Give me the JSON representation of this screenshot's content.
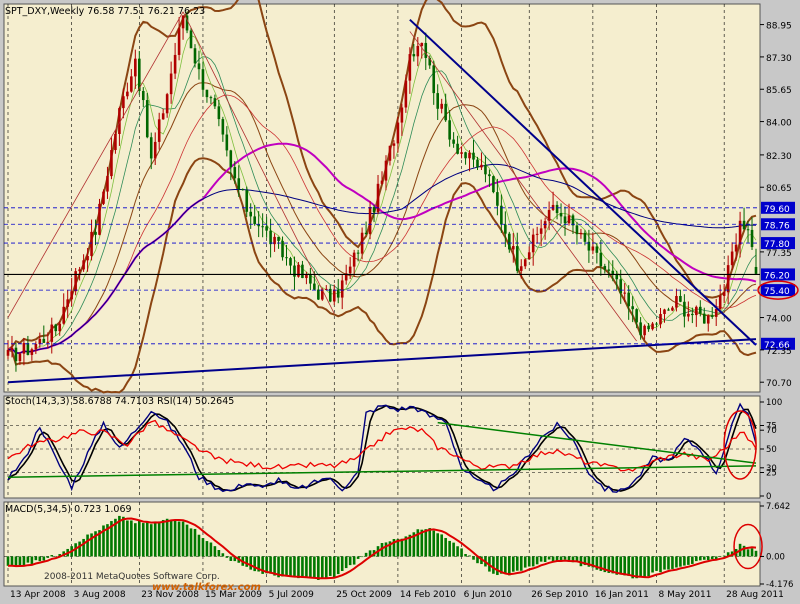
{
  "header": {
    "symbol_line": "SPT_DXY,Weekly  76.58 77.51 76.21 76.23"
  },
  "colors": {
    "background": "#f5eecf",
    "frame": "#c8c8c8",
    "bull": "#b00000",
    "bear": "#006600",
    "bollinger": "#8b4513",
    "ma_magenta": "#c000c0",
    "ma_navy": "#000080",
    "trend_line": "#00008b",
    "stoch_blue": "#00007f",
    "stoch_black": "#000000",
    "rsi_red": "#ee0000",
    "stoch_trend_green": "#008000",
    "macd_hist": "#007800",
    "macd_signal": "#dd0000",
    "annotation": "#dd0000",
    "level_box": "#0000cc"
  },
  "price_panel": {
    "y_ticks": [
      "88.95",
      "87.30",
      "85.65",
      "84.00",
      "82.30",
      "80.65",
      "77.35",
      "74.00",
      "72.35",
      "70.70"
    ],
    "level_labels": [
      {
        "label": "79.60",
        "value": 79.6,
        "line": "dash",
        "tag_color": "#0000cc"
      },
      {
        "label": "78.76",
        "value": 78.76,
        "line": "dash",
        "tag_color": "#0000cc"
      },
      {
        "label": "77.80",
        "value": 77.8,
        "line": "dash",
        "tag_color": "#0000cc"
      },
      {
        "label": "76.20",
        "value": 76.2,
        "line": "solid",
        "tag_color": "#0000cc"
      },
      {
        "label": "75.40",
        "value": 75.4,
        "line": "dash",
        "tag_color": "#0000cc",
        "circled": true
      },
      {
        "label": "72.66",
        "value": 72.66,
        "line": "dash",
        "tag_color": "#0000cc"
      }
    ]
  },
  "stoch_panel": {
    "title": "Stoch(14,3,3) 58.6788 74.7103  RSI(14) 50.2645",
    "y_ticks": [
      "100",
      "75",
      "70",
      "50",
      "30",
      "25",
      "0"
    ]
  },
  "macd_panel": {
    "title": "MACD(5,34,5) 0.723 1.069",
    "y_ticks": [
      "7.642",
      "0.00",
      "-4.176"
    ]
  },
  "x_axis": {
    "labels": [
      "13 Apr 2008",
      "3 Aug 2008",
      "23 Nov 2008",
      "15 Mar 2009",
      "5 Jul 2009",
      "25 Oct 2009",
      "14 Feb 2010",
      "6 Jun 2010",
      "26 Sep 2010",
      "16 Jan 2011",
      "8 May 2011",
      "28 Aug 2011"
    ]
  },
  "watermark": {
    "left_text": "2008-2011 MetaQuotes Software Corp.",
    "right_text": "www.talkforex.com"
  },
  "chart_data": [
    {
      "type": "candlestick",
      "title": "SPT_DXY,Weekly",
      "ylim": [
        70.2,
        90.0
      ],
      "x_range": [
        "13 Apr 2008",
        "28 Aug 2011"
      ],
      "last_bar": {
        "open": 76.58,
        "high": 77.51,
        "low": 76.21,
        "close": 76.23
      },
      "close_path": [
        [
          0,
          72.0
        ],
        [
          6,
          72.5
        ],
        [
          12,
          73.4
        ],
        [
          16,
          75.7
        ],
        [
          22,
          78.5
        ],
        [
          28,
          84.5
        ],
        [
          32,
          87.3
        ],
        [
          36,
          82.0
        ],
        [
          40,
          85.5
        ],
        [
          44,
          89.5
        ],
        [
          48,
          86.5
        ],
        [
          52,
          84.5
        ],
        [
          56,
          81.5
        ],
        [
          60,
          79.6
        ],
        [
          66,
          78.0
        ],
        [
          72,
          76.5
        ],
        [
          78,
          75.3
        ],
        [
          82,
          75.0
        ],
        [
          86,
          76.5
        ],
        [
          90,
          78.6
        ],
        [
          94,
          81.0
        ],
        [
          98,
          84.0
        ],
        [
          101,
          87.5
        ],
        [
          104,
          88.3
        ],
        [
          108,
          85.0
        ],
        [
          112,
          83.0
        ],
        [
          116,
          82.0
        ],
        [
          120,
          81.5
        ],
        [
          124,
          79.0
        ],
        [
          128,
          76.8
        ],
        [
          132,
          77.8
        ],
        [
          136,
          79.5
        ],
        [
          140,
          79.2
        ],
        [
          144,
          78.0
        ],
        [
          148,
          77.0
        ],
        [
          152,
          76.0
        ],
        [
          156,
          74.5
        ],
        [
          160,
          73.2
        ],
        [
          164,
          74.0
        ],
        [
          168,
          74.8
        ],
        [
          172,
          74.2
        ],
        [
          176,
          74.0
        ],
        [
          180,
          75.5
        ],
        [
          182,
          77.0
        ],
        [
          184,
          78.5
        ],
        [
          186,
          78.8
        ],
        [
          188,
          76.2
        ]
      ],
      "overlays": [
        "bollinger_bands",
        "moving_averages",
        "trend_lines"
      ]
    },
    {
      "type": "line",
      "title": "Stoch(14,3,3) / RSI(14)",
      "ylim": [
        0,
        100
      ],
      "series": [
        {
          "name": "Stoch main",
          "last": 58.6788
        },
        {
          "name": "Stoch signal",
          "last": 74.7103
        },
        {
          "name": "RSI(14)",
          "last": 50.2645
        }
      ],
      "stoch_path": [
        [
          0,
          20
        ],
        [
          4,
          38
        ],
        [
          8,
          75
        ],
        [
          12,
          40
        ],
        [
          16,
          10
        ],
        [
          20,
          45
        ],
        [
          24,
          78
        ],
        [
          28,
          50
        ],
        [
          32,
          70
        ],
        [
          36,
          92
        ],
        [
          40,
          78
        ],
        [
          44,
          55
        ],
        [
          48,
          20
        ],
        [
          52,
          10
        ],
        [
          56,
          5
        ],
        [
          60,
          15
        ],
        [
          64,
          8
        ],
        [
          68,
          18
        ],
        [
          72,
          6
        ],
        [
          76,
          12
        ],
        [
          80,
          20
        ],
        [
          84,
          8
        ],
        [
          88,
          25
        ],
        [
          90,
          88
        ],
        [
          94,
          96
        ],
        [
          98,
          92
        ],
        [
          102,
          95
        ],
        [
          106,
          85
        ],
        [
          110,
          80
        ],
        [
          114,
          30
        ],
        [
          118,
          15
        ],
        [
          122,
          8
        ],
        [
          126,
          18
        ],
        [
          130,
          40
        ],
        [
          134,
          62
        ],
        [
          138,
          75
        ],
        [
          142,
          60
        ],
        [
          146,
          25
        ],
        [
          150,
          8
        ],
        [
          154,
          5
        ],
        [
          158,
          18
        ],
        [
          162,
          40
        ],
        [
          166,
          38
        ],
        [
          170,
          60
        ],
        [
          174,
          50
        ],
        [
          178,
          25
        ],
        [
          182,
          75
        ],
        [
          184,
          95
        ],
        [
          186,
          88
        ],
        [
          188,
          58
        ]
      ],
      "rsi_path": [
        [
          0,
          40
        ],
        [
          6,
          55
        ],
        [
          12,
          60
        ],
        [
          18,
          68
        ],
        [
          24,
          68
        ],
        [
          30,
          55
        ],
        [
          36,
          80
        ],
        [
          40,
          70
        ],
        [
          46,
          55
        ],
        [
          52,
          40
        ],
        [
          58,
          35
        ],
        [
          64,
          32
        ],
        [
          70,
          30
        ],
        [
          76,
          33
        ],
        [
          82,
          32
        ],
        [
          88,
          40
        ],
        [
          92,
          55
        ],
        [
          96,
          68
        ],
        [
          100,
          72
        ],
        [
          104,
          70
        ],
        [
          108,
          52
        ],
        [
          112,
          45
        ],
        [
          116,
          35
        ],
        [
          120,
          30
        ],
        [
          126,
          32
        ],
        [
          132,
          42
        ],
        [
          136,
          48
        ],
        [
          140,
          45
        ],
        [
          146,
          35
        ],
        [
          152,
          30
        ],
        [
          158,
          28
        ],
        [
          164,
          40
        ],
        [
          170,
          45
        ],
        [
          176,
          38
        ],
        [
          180,
          50
        ],
        [
          184,
          68
        ],
        [
          186,
          62
        ],
        [
          188,
          50
        ]
      ]
    },
    {
      "type": "bar",
      "title": "MACD(5,34,5)",
      "ylim": [
        -4.176,
        7.642
      ],
      "series": [
        {
          "name": "MACD",
          "last": 0.723
        },
        {
          "name": "Signal",
          "last": 1.069
        }
      ],
      "macd_path": [
        [
          0,
          -1.5
        ],
        [
          6,
          -1.0
        ],
        [
          12,
          0.2
        ],
        [
          18,
          2.5
        ],
        [
          24,
          4.5
        ],
        [
          28,
          6.0
        ],
        [
          32,
          5.2
        ],
        [
          36,
          5.0
        ],
        [
          40,
          5.6
        ],
        [
          44,
          5.5
        ],
        [
          48,
          3.5
        ],
        [
          52,
          1.5
        ],
        [
          56,
          -0.5
        ],
        [
          60,
          -1.8
        ],
        [
          66,
          -2.8
        ],
        [
          72,
          -3.2
        ],
        [
          78,
          -3.5
        ],
        [
          82,
          -3.0
        ],
        [
          86,
          -1.5
        ],
        [
          90,
          0.5
        ],
        [
          94,
          1.8
        ],
        [
          98,
          2.6
        ],
        [
          102,
          3.8
        ],
        [
          106,
          4.2
        ],
        [
          110,
          2.8
        ],
        [
          114,
          1.0
        ],
        [
          118,
          -0.8
        ],
        [
          122,
          -2.5
        ],
        [
          126,
          -2.8
        ],
        [
          130,
          -1.8
        ],
        [
          134,
          -0.8
        ],
        [
          138,
          -0.5
        ],
        [
          142,
          -0.8
        ],
        [
          146,
          -1.8
        ],
        [
          150,
          -2.2
        ],
        [
          154,
          -2.8
        ],
        [
          158,
          -3.2
        ],
        [
          162,
          -2.6
        ],
        [
          166,
          -1.8
        ],
        [
          170,
          -1.2
        ],
        [
          174,
          -0.8
        ],
        [
          178,
          -0.5
        ],
        [
          181,
          0.5
        ],
        [
          184,
          1.8
        ],
        [
          186,
          1.3
        ],
        [
          188,
          0.7
        ]
      ]
    }
  ]
}
